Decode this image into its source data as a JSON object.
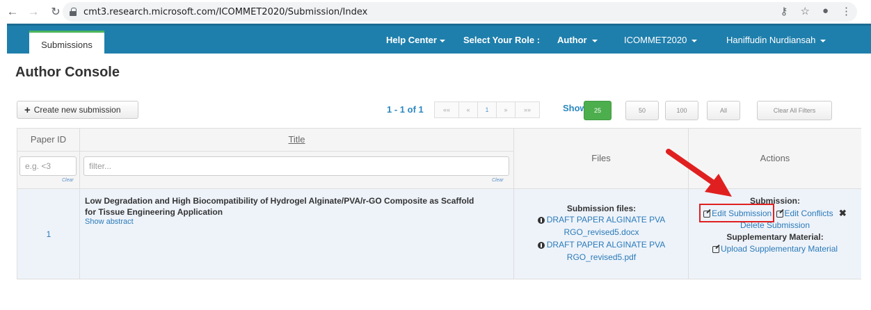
{
  "browser": {
    "url": "cmt3.research.microsoft.com/ICOMMET2020/Submission/Index"
  },
  "nav": {
    "tab": "Submissions",
    "help_center": "Help Center",
    "role_label": "Select Your Role :",
    "role_value": "Author",
    "conference": "ICOMMET2020",
    "user": "Haniffudin Nurdiansah"
  },
  "page": {
    "title": "Author Console"
  },
  "toolbar": {
    "create_label": "Create new submission",
    "pager_count": "1 - 1 of 1",
    "pager_first": "««",
    "pager_prev": "«",
    "pager_current": "1",
    "pager_next": "»",
    "pager_last": "»»",
    "show_label": "Show:",
    "sizes": [
      "25",
      "50",
      "100",
      "All"
    ],
    "active_size": "25",
    "clear_filters": "Clear All Filters"
  },
  "table": {
    "headers": {
      "paper_id": "Paper ID",
      "title": "Title",
      "files": "Files",
      "actions": "Actions"
    },
    "filters": {
      "paper_id_placeholder": "e.g. <3",
      "title_placeholder": "filter...",
      "clear": "Clear"
    },
    "rows": [
      {
        "paper_id": "1",
        "title_line1": "Low Degradation and High Biocompatibility of Hydrogel Alginate/PVA/r-GO Composite as Scaffold",
        "title_line2": "for Tissue Engineering Application",
        "show_abstract": "Show abstract",
        "files_label": "Submission files:",
        "file1_line1": "DRAFT PAPER ALGINATE PVA",
        "file1_line2": "RGO_revised5.docx",
        "file2_line1": "DRAFT PAPER ALGINATE PVA",
        "file2_line2": "RGO_revised5.pdf",
        "actions": {
          "submission_label": "Submission:",
          "edit_submission": "Edit Submission",
          "edit_conflicts": "Edit Conflicts",
          "delete_submission": "Delete Submission",
          "supplementary_label": "Supplementary Material:",
          "upload_supplementary": "Upload Supplementary Material"
        }
      }
    ]
  },
  "colors": {
    "navbar": "#1f7fac",
    "active_tab_accent": "#4cb45c",
    "link": "#2a7ab8",
    "active_size": "#4cae4c",
    "annotation": "#e02020",
    "row_highlight": "#eef3fa"
  }
}
